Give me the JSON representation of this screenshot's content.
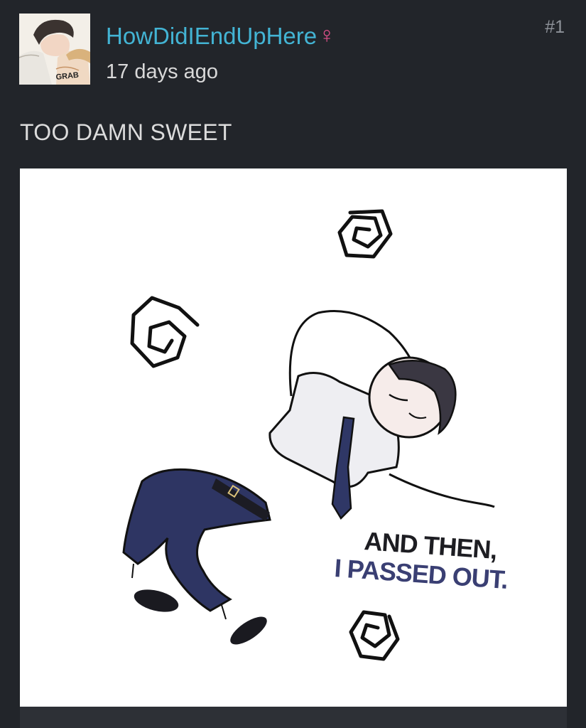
{
  "post": {
    "author": "HowDidIEndUpHere",
    "gender_icon": "♀",
    "timestamp": "17 days ago",
    "number": "#1",
    "text": "TOO DAMN SWEET",
    "avatar_caption": "GRAB"
  },
  "image": {
    "caption_line1": "AND THEN,",
    "caption_line2": "I PASSED OUT."
  },
  "colors": {
    "background": "#22252a",
    "username": "#43b4d4",
    "gender_icon": "#e2508c",
    "caption_line2": "#3a3f73"
  }
}
